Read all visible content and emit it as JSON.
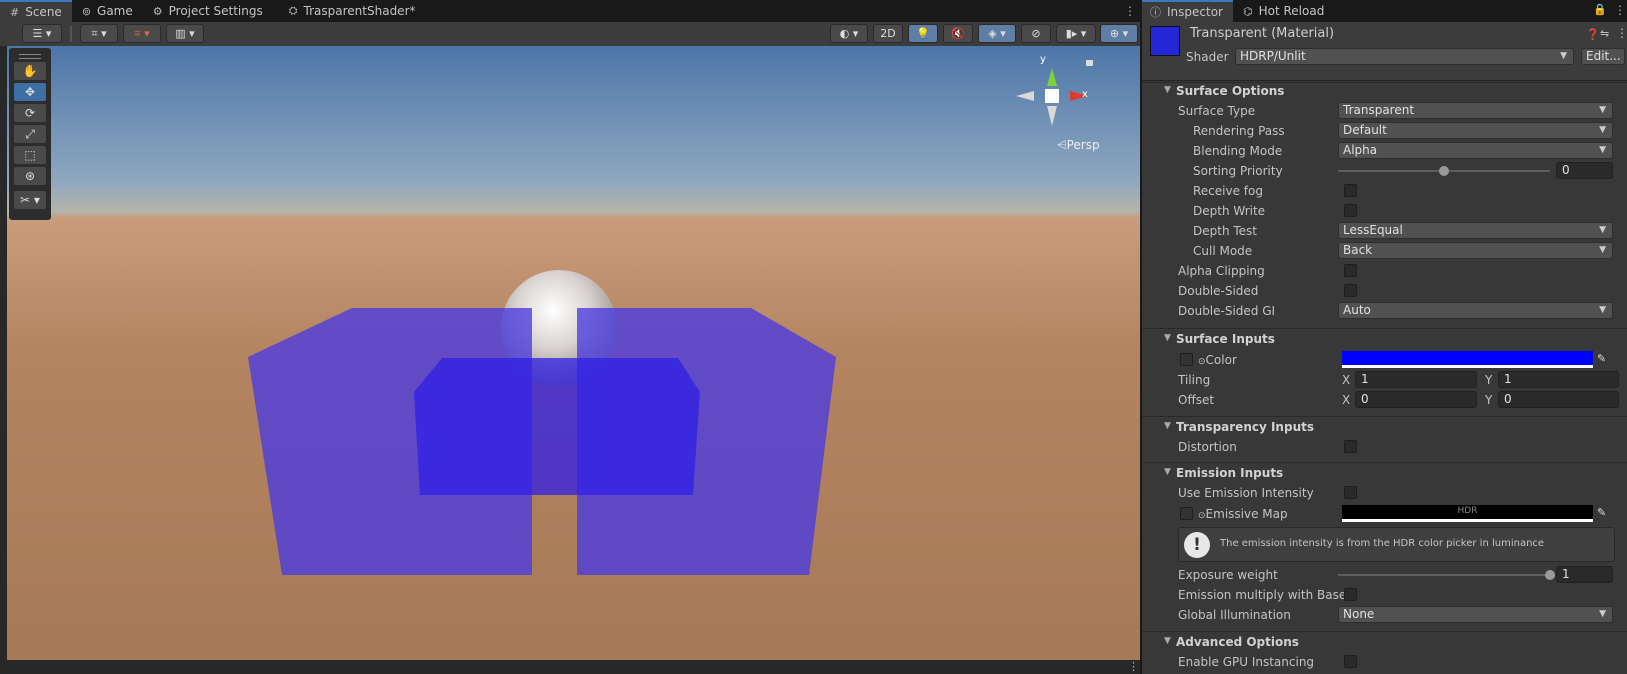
{
  "scene_tabs": [
    {
      "icon": "hash-icon",
      "label": "Scene"
    },
    {
      "icon": "gamepad-icon",
      "label": "Game"
    },
    {
      "icon": "gear-icon",
      "label": "Project Settings"
    },
    {
      "icon": "shader-icon",
      "label": "TrasparentShader*"
    }
  ],
  "toolbar": {
    "mode_2d": "2D"
  },
  "gizmo": {
    "y_label": "y",
    "x_label": "x",
    "persp_label": "Persp"
  },
  "inspector": {
    "tabs": [
      {
        "label": "Inspector"
      },
      {
        "label": "Hot Reload"
      }
    ],
    "material_title": "Transparent (Material)",
    "shader_label": "Shader",
    "shader_value": "HDRP/Unlit",
    "edit_button": "Edit...",
    "material_color": "#2626d9"
  },
  "surface_options": {
    "title": "Surface Options",
    "surface_type": {
      "label": "Surface Type",
      "value": "Transparent"
    },
    "rendering_pass": {
      "label": "Rendering Pass",
      "value": "Default"
    },
    "blending_mode": {
      "label": "Blending Mode",
      "value": "Alpha"
    },
    "sorting_priority": {
      "label": "Sorting Priority",
      "value": "0",
      "slider_fraction": 0.5
    },
    "receive_fog": {
      "label": "Receive fog",
      "checked": false
    },
    "depth_write": {
      "label": "Depth Write",
      "checked": false
    },
    "depth_test": {
      "label": "Depth Test",
      "value": "LessEqual"
    },
    "cull_mode": {
      "label": "Cull Mode",
      "value": "Back"
    },
    "alpha_clipping": {
      "label": "Alpha Clipping",
      "checked": false
    },
    "double_sided": {
      "label": "Double-Sided",
      "checked": false
    },
    "double_sided_gi": {
      "label": "Double-Sided GI",
      "value": "Auto"
    }
  },
  "surface_inputs": {
    "title": "Surface Inputs",
    "color": {
      "label": "Color",
      "value": "#0000ff"
    },
    "tiling": {
      "label": "Tiling",
      "x_label": "X",
      "x": "1",
      "y_label": "Y",
      "y": "1"
    },
    "offset": {
      "label": "Offset",
      "x_label": "X",
      "x": "0",
      "y_label": "Y",
      "y": "0"
    }
  },
  "transparency_inputs": {
    "title": "Transparency Inputs",
    "distortion": {
      "label": "Distortion",
      "checked": false
    }
  },
  "emission_inputs": {
    "title": "Emission Inputs",
    "use_emission_intensity": {
      "label": "Use Emission Intensity",
      "checked": false
    },
    "emissive_map": {
      "label": "Emissive Map",
      "hdr_text": "HDR",
      "value": "#000000"
    },
    "info_text": "The emission intensity is from the HDR color picker in luminance",
    "exposure_weight": {
      "label": "Exposure weight",
      "value": "1",
      "slider_fraction": 1.0
    },
    "emission_multiply": {
      "label": "Emission multiply with Base",
      "checked": false
    },
    "global_illumination": {
      "label": "Global Illumination",
      "value": "None"
    }
  },
  "advanced_options": {
    "title": "Advanced Options",
    "gpu_instancing": {
      "label": "Enable GPU Instancing",
      "checked": false
    }
  }
}
